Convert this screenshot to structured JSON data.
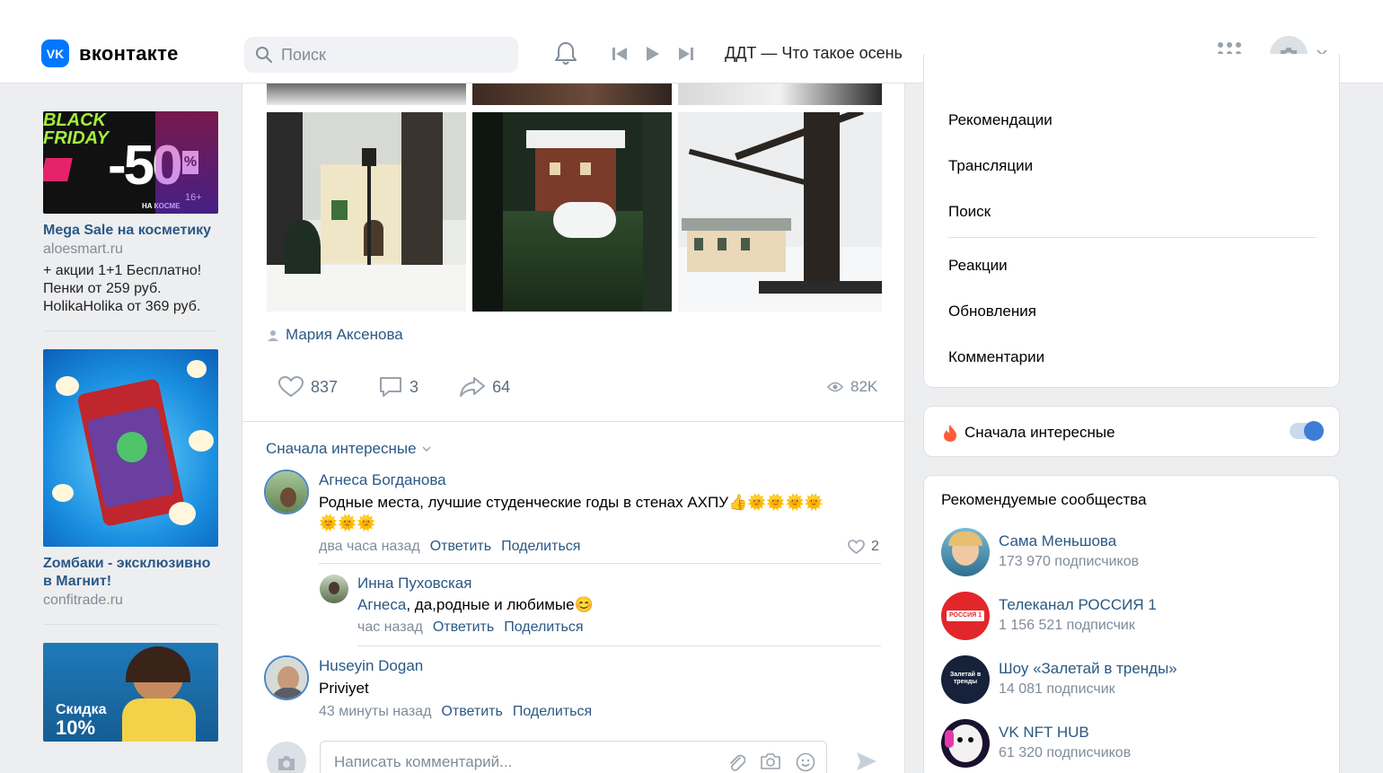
{
  "header": {
    "logo_mark": "VK",
    "logo_text": "вконтакте",
    "search_placeholder": "Поиск",
    "now_playing": "ДДТ — Что такое осень"
  },
  "ads": [
    {
      "title": "Mega Sale на косметику",
      "domain": "aloesmart.ru",
      "description": "+ акции 1+1 Бесплатно! Пенки от 259 руб. HolikaHolika от 369 руб.",
      "image_texts": {
        "black": "BLACK",
        "friday": "FRIDAY",
        "minus50": "-50",
        "pct": "%",
        "age": "16+",
        "small": "НА КОСМЕ"
      }
    },
    {
      "title": "Zомбаки - эксклюзивно в Магнит!",
      "domain": "confitrade.ru"
    },
    {
      "image_texts": {
        "skidka": "Скидка",
        "pct": "10%"
      }
    }
  ],
  "post": {
    "author": "Мария Аксенова",
    "likes": "837",
    "comments": "3",
    "shares": "64",
    "views": "82K",
    "sort_label": "Сначала интересные"
  },
  "comments": [
    {
      "author": "Агнеса Богданова",
      "text_line1": "Родные места, лучшие студенческие годы в стенах АХПУ👍🌞🌞🌞🌞",
      "text_line2": "🌞🌞🌞",
      "time": "два часа назад",
      "reply": "Ответить",
      "share": "Поделиться",
      "likes": "2"
    },
    {
      "author": "Инна Пуховская",
      "mention": "Агнеса",
      "text": ", да,родные и любимые😊",
      "time": "час назад",
      "reply": "Ответить",
      "share": "Поделиться"
    },
    {
      "author": "Huseyin Dogan",
      "text": "Priviyet",
      "time": "43 минуты назад",
      "reply": "Ответить",
      "share": "Поделиться"
    }
  ],
  "composer": {
    "placeholder": "Написать комментарий..."
  },
  "right_menu": {
    "items": [
      "Рекомендации",
      "Трансляции",
      "Поиск"
    ],
    "items2": [
      "Реакции",
      "Обновления",
      "Комментарии"
    ]
  },
  "interesting_first": {
    "label": "Сначала интересные",
    "enabled": true
  },
  "recommended": {
    "title": "Рекомендуемые сообщества",
    "items": [
      {
        "name": "Сама Меньшова",
        "subs": "173 970 подписчиков"
      },
      {
        "name": "Телеканал РОССИЯ 1",
        "subs": "1 156 521 подписчик",
        "badge": "РОССИЯ 1"
      },
      {
        "name": "Шоу «Залетай в тренды»",
        "subs": "14 081 подписчик",
        "badge": "Залетай в тренды"
      },
      {
        "name": "VK NFT HUB",
        "subs": "61 320 подписчиков"
      }
    ]
  },
  "colors": {
    "accent": "#0077ff",
    "link": "#2a5885",
    "toggle": "#3f7dd5",
    "background": "#edeef0"
  }
}
